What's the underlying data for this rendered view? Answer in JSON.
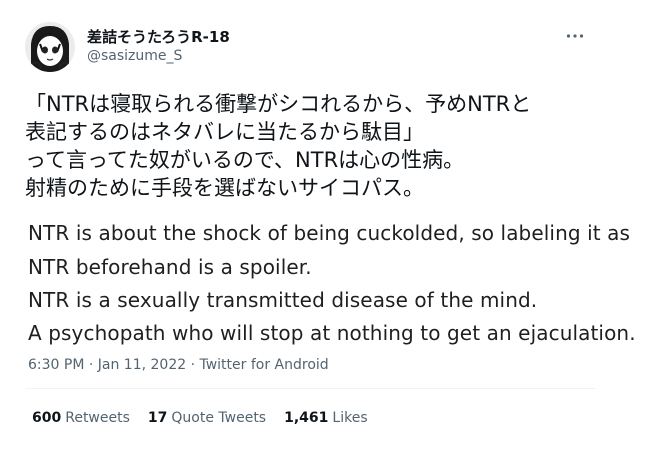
{
  "tweet": {
    "display_name": "差詰そうたろうR-18",
    "handle": "@sasizume_S",
    "more_icon": "more-horizontal-icon",
    "japanese_lines": [
      "「NTRは寝取られる衝撃がシコれるから、予めNTRと",
      "表記するのはネタバレに当たるから駄目」",
      "って言ってた奴がいるので、NTRは心の性病。",
      "射精のために手段を選ばないサイコパス。"
    ],
    "translation_lines": [
      "NTR is about the shock of being cuckolded, so labeling it as",
      "NTR beforehand is a spoiler.",
      "NTR is a sexually transmitted disease of the mind.",
      "A psychopath who will stop at nothing to get an ejaculation."
    ],
    "meta": "6:30 PM · Jan 11, 2022 · Twitter for Android",
    "stats": {
      "retweets_count": "600",
      "retweets_label": "Retweets",
      "quotes_count": "17",
      "quotes_label": "Quote Tweets",
      "likes_count": "1,461",
      "likes_label": "Likes"
    }
  }
}
